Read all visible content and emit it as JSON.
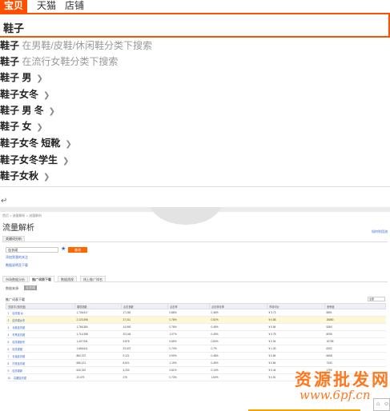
{
  "tabs": [
    {
      "label": "宝贝",
      "active": true
    },
    {
      "label": "天猫",
      "active": false
    },
    {
      "label": "店铺",
      "active": false
    }
  ],
  "search": {
    "value": "鞋子"
  },
  "suggestions": [
    {
      "text": "鞋子",
      "cat": "在男鞋/皮鞋/休闲鞋分类下搜索"
    },
    {
      "text": "鞋子",
      "cat": "在流行女鞋分类下搜索"
    },
    {
      "text": "鞋子 男"
    },
    {
      "text": "鞋子女冬"
    },
    {
      "text": "鞋子 男 冬"
    },
    {
      "text": "鞋子 女"
    },
    {
      "text": "鞋子女冬 短靴"
    },
    {
      "text": "鞋子女冬学生"
    },
    {
      "text": "鞋子女秋"
    }
  ],
  "panel": {
    "breadcrumb": "首页 > 流量解析 > 流量解析",
    "title": "流量解析",
    "right_link": "如何利用流",
    "mini_tab": "关键词分析",
    "input_value": "连衣裙",
    "button_label": "查询",
    "link_add": "添加到我的关注",
    "link_data": "数据说明及下载",
    "sub_tabs": [
      "市场数据分析",
      "推广词表下载",
      "数据透视",
      "线上推广排名"
    ],
    "filter_label": "数据来源:",
    "filter_btn": "连衣裙",
    "table_label": "推广词表下载",
    "select_value": "全部"
  },
  "table": {
    "headers": [
      "关键词 (相关度)",
      "展现指数",
      "点击指数",
      "点击率",
      "点击转化率",
      "市场均价",
      "竞争度"
    ],
    "rows": [
      {
        "rank": "1",
        "kw": "连衣裙 女",
        "v": [
          "1,706,617",
          "17,262",
          "0.88%",
          "0.48%",
          "¥ 3.73",
          "6891"
        ]
      },
      {
        "rank": "2",
        "kw": "连衣裙女冬",
        "v": [
          "2,123,398",
          "27,311",
          "0.78%",
          "0.52%",
          "¥ 0.88",
          "15860"
        ]
      },
      {
        "rank": "3",
        "kw": "长款连衣裙",
        "v": [
          "1,766,384",
          "14,949",
          "0.76%",
          "0.48%",
          "¥ 0.84",
          "5360"
        ]
      },
      {
        "rank": "4",
        "kw": "冬季连衣裙",
        "v": [
          "1,714,398",
          "20,146",
          "1.07%",
          "0.49%",
          "¥ 0.78",
          "8095"
        ]
      },
      {
        "rank": "5",
        "kw": "连衣裙秋冬",
        "v": [
          "1,407,941",
          "9,878",
          "0.65%",
          "0.84%",
          "¥ 0.94",
          "10755"
        ]
      },
      {
        "rank": "6",
        "kw": "连衣裙裙",
        "v": [
          "1,666,611",
          "23,407",
          "0.73%",
          "0.7%",
          "¥ 1.33",
          "6302"
        ]
      },
      {
        "rank": "7",
        "kw": "长袖连衣裙",
        "v": [
          "860,372",
          "9,121",
          "0.90%",
          "0.48%",
          "¥ 0.84",
          "6658"
        ]
      },
      {
        "rank": "8",
        "kw": "打底连衣裙",
        "v": [
          "656,121",
          "8,621",
          "1.19%",
          "0.45%",
          "¥ 0.84",
          "7330"
        ]
      },
      {
        "rank": "9",
        "kw": "连衣裙新",
        "v": [
          "626,319",
          "4,233",
          "0.61%",
          "0.13%",
          "¥ 0.44",
          "1790"
        ]
      },
      {
        "rank": "10",
        "kw": "高腰连衣裙",
        "v": [
          "22,479",
          "276",
          "0.73%",
          "1.60%",
          "¥ 0.51",
          "2651"
        ]
      }
    ]
  },
  "watermark": {
    "line1": "资源批发网",
    "line2": "www.6pf.cn"
  },
  "corner_icons": [
    "lock-icon",
    "user-icon"
  ]
}
